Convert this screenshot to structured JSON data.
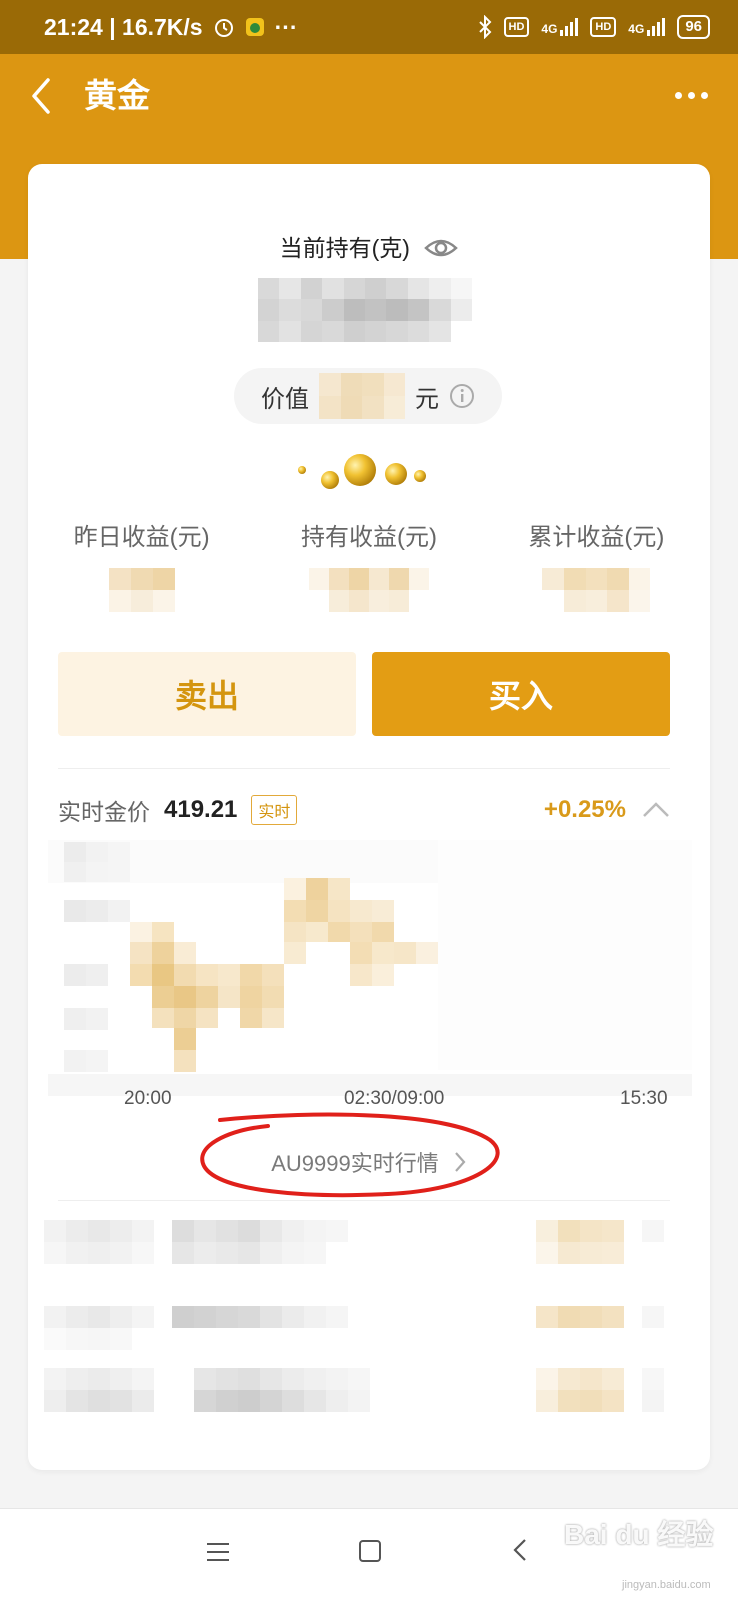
{
  "status_bar": {
    "time_speed": "21:24 | 16.7K/s",
    "more": "···",
    "hd1": "HD",
    "net1": "4G",
    "hd2": "HD",
    "net2": "4G",
    "battery": "96"
  },
  "nav": {
    "title": "黄金"
  },
  "holding": {
    "label": "当前持有(克)",
    "value_prefix": "价值",
    "value_suffix": "元"
  },
  "stats": [
    {
      "label": "昨日收益(元)"
    },
    {
      "label": "持有收益(元)"
    },
    {
      "label": "累计收益(元)"
    }
  ],
  "actions": {
    "sell": "卖出",
    "buy": "买入"
  },
  "price": {
    "label": "实时金价",
    "value": "419.21",
    "badge": "实时",
    "change": "+0.25%",
    "change_color": "#d99a1a"
  },
  "chart_axis": {
    "x_ticks": [
      "20:00",
      "02:30/09:00",
      "15:30"
    ]
  },
  "au_link": {
    "label": "AU9999实时行情"
  },
  "watermark": {
    "main": "Bai du 经验",
    "sub": "jingyan.baidu.com"
  },
  "colors": {
    "header": "#dc9612",
    "statusbar": "#9a6a06",
    "buy_button": "#e39d14",
    "sell_button_bg": "#fdf3e2",
    "sell_text": "#d4950f",
    "annotation_circle": "#e0201a"
  }
}
